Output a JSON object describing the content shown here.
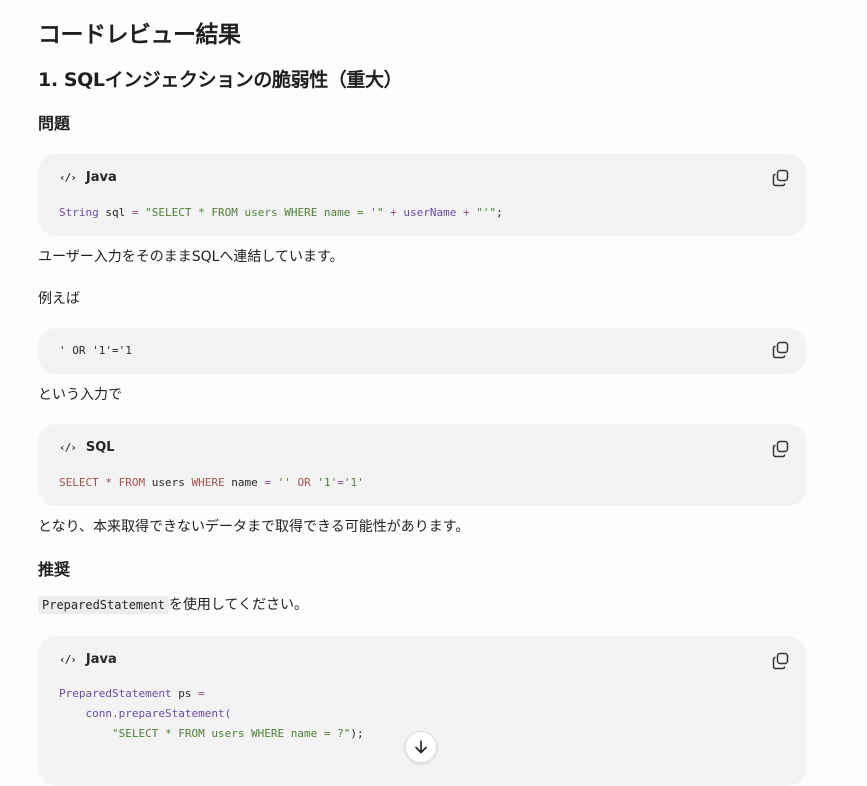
{
  "title": "コードレビュー結果",
  "section1": {
    "heading": "1. SQLインジェクションの脆弱性（重大）",
    "problem_heading": "問題",
    "code1": {
      "language": "Java",
      "tokens": [
        "String",
        " sql ",
        "=",
        " ",
        "\"SELECT * FROM users WHERE name = '\"",
        " ",
        "+",
        " userName ",
        "+",
        " ",
        "\"'\"",
        ";"
      ]
    },
    "para1": "ユーザー入力をそのままSQLへ連結しています。",
    "para2": "例えば",
    "code2": {
      "text": "' OR '1'='1"
    },
    "para3": "という入力で",
    "code3": {
      "language": "SQL",
      "tokens": [
        "SELECT",
        " ",
        "*",
        " ",
        "FROM",
        " users ",
        "WHERE",
        " name ",
        "=",
        " ",
        "''",
        " ",
        "OR",
        " ",
        "'1'",
        "=",
        "'1'"
      ]
    },
    "para4": "となり、本来取得できないデータまで取得できる可能性があります。",
    "recommend_heading": "推奨",
    "recommend_code_inline": "PreparedStatement",
    "recommend_text": "を使用してください。",
    "code4": {
      "language": "Java",
      "line1": [
        "PreparedStatement",
        " ps ",
        "="
      ],
      "line2": [
        "    conn.prepareStatement("
      ],
      "line3": [
        "        ",
        "\"SELECT * FROM users WHERE name = ?\"",
        ");"
      ]
    }
  },
  "icons": {
    "code": "code-icon",
    "copy": "copy-icon",
    "scroll": "arrow-down-icon"
  }
}
